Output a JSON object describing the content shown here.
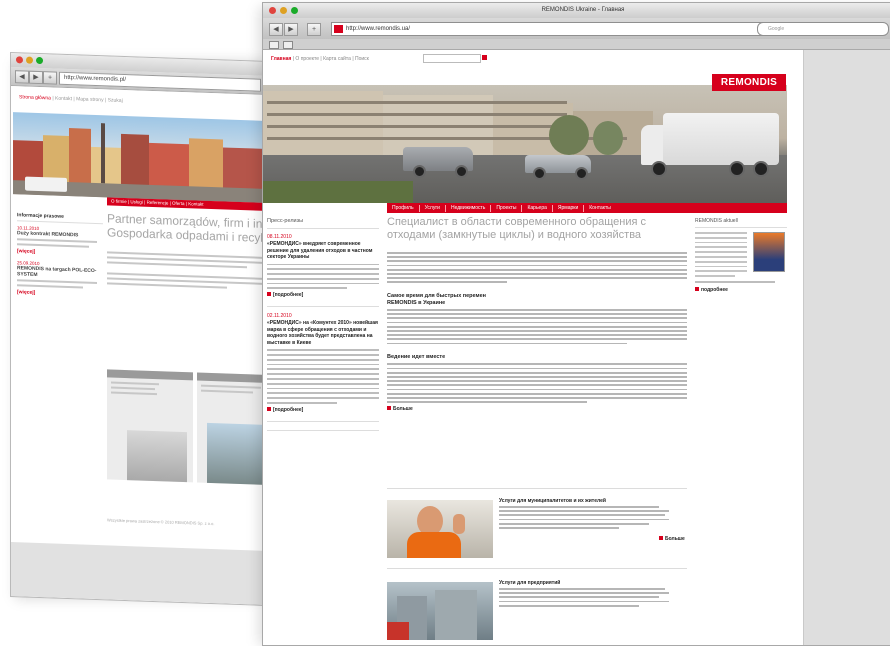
{
  "back_window": {
    "url": "http://www.remondis.pl/",
    "top_nav": {
      "active": "Strona główna",
      "rest": "  |  Kontakt  |  Mapa strony  |  Szukaj"
    },
    "menu": "O firmie  |  Usługi  |  Referencje  |  Oferta  |  Kontakt",
    "news_header": "Informacje prasowe",
    "news": [
      {
        "date": "10.11.2010",
        "title": "Duży kontrakt REMONDIS",
        "more": "[więcej]"
      },
      {
        "date": "25.09.2010",
        "title": "REMONDIS na targach POL-ECO-SYSTEM",
        "more": "[więcej]"
      }
    ],
    "headline_1": "Partner samorządów, firm i insty",
    "headline_2": "Gospodarka odpadami i recyklin",
    "footer": "Wszystkie prawa zastrzeżone © 2010 REMONDIS Sp. z o.o."
  },
  "front_window": {
    "window_title": "REMONDIS Ukraine - Главная",
    "url": "http://www.remondis.ua/",
    "search_placeholder": "Google",
    "top_nav": {
      "active": "Главная",
      "rest": "  |  О проекте  |  Карта сайта  |  Поиск"
    },
    "logo": "REMONDIS",
    "menu": [
      "Профиль",
      "Услуги",
      "Недвижимость",
      "Проекты",
      "Карьера",
      "Ярмарки",
      "Контакты"
    ],
    "press_header": "Пресс-релизы",
    "press": [
      {
        "date": "08.11.2010",
        "title": "«РЕМОНДИС» внедряет современное решение для удаления отходов в частном секторе Украины",
        "more": "[подробнее]"
      },
      {
        "date": "02.11.2010",
        "title": "«РЕМОНДИС» на «Комунтех 2010» новейшая марка в сфере обращения с отходами и водного хозяйства будет представлена на выставке в Киеве",
        "more": "[подробнее]"
      }
    ],
    "headline": "Специалист в области современного обращения с отходами (замкнутые циклы) и водного хозяйства",
    "sections": [
      {
        "title": "Самое время для быстрых перемен\nREMONDIS в Украине"
      },
      {
        "title": "Ведение идет вместе",
        "more": "Больше"
      }
    ],
    "teasers": [
      {
        "title": "Услуги для муниципалитетов и их жителей",
        "more": "Больше"
      },
      {
        "title": "Услуги для предприятий"
      }
    ],
    "right_header": "REMONDIS aktuell",
    "right_more": "подробнее"
  }
}
